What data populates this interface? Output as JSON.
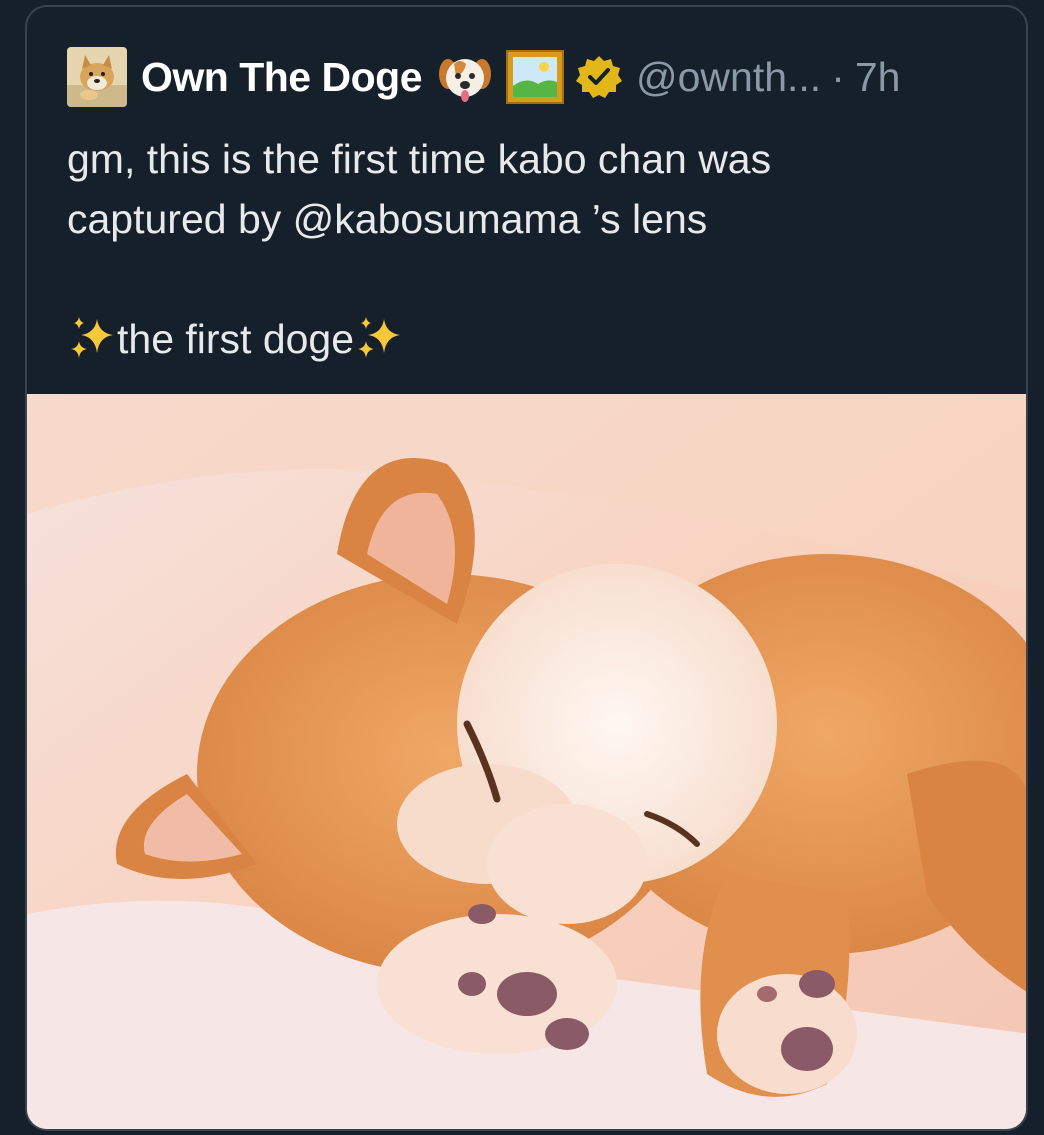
{
  "tweet": {
    "author": {
      "display_name": "Own The Doge",
      "handle": "@ownth...",
      "separator": "·",
      "time": "7h",
      "avatar_icon": "doge-avatar",
      "name_emojis": [
        "dog-face-emoji-icon",
        "framed-picture-emoji-icon"
      ],
      "badge_icon": "gold-verified-badge-icon",
      "badge_color": "#e2b719"
    },
    "text_line_1": "gm, this is the first time kabo chan was",
    "text_line_2": "captured by @kabosumama ’s lens",
    "text_line_3": "the first doge",
    "sparkle_icon": "sparkles-emoji-icon",
    "media": {
      "kind": "photo",
      "subject_icon": "sleeping-shiba-inu-photo"
    }
  },
  "colors": {
    "background": "#15202b",
    "card_border": "#38444d",
    "primary_text": "#e7e9ea",
    "secondary_text": "#8b98a5"
  }
}
